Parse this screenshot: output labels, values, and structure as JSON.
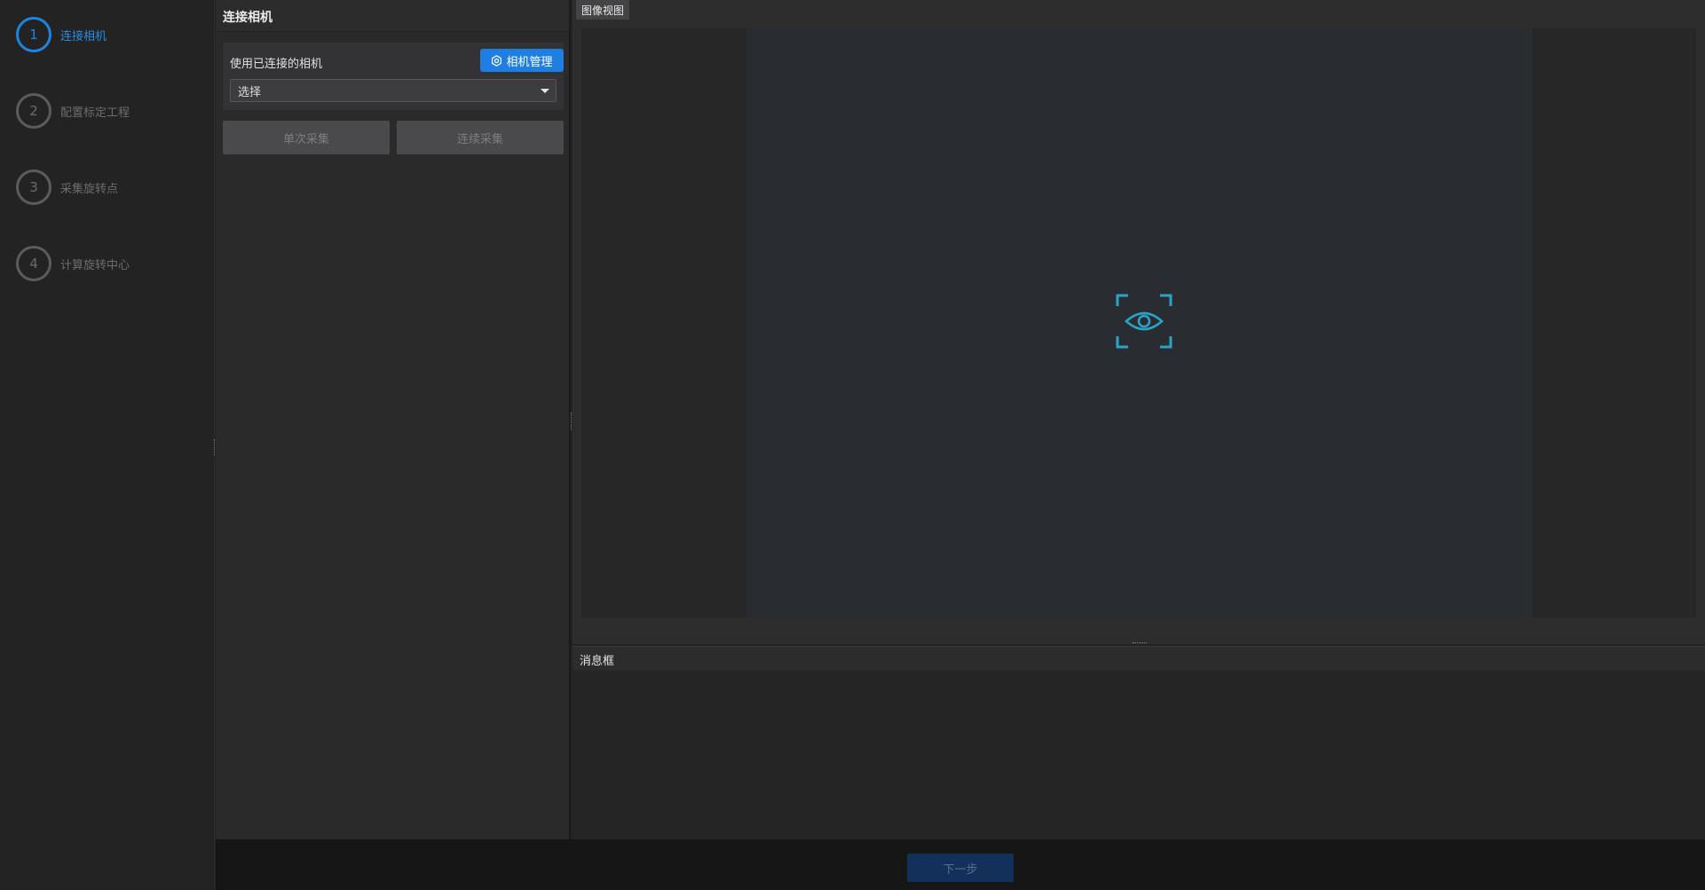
{
  "steps": [
    {
      "number": "1",
      "label": "连接相机",
      "active": true
    },
    {
      "number": "2",
      "label": "配置标定工程",
      "active": false
    },
    {
      "number": "3",
      "label": "采集旋转点",
      "active": false
    },
    {
      "number": "4",
      "label": "计算旋转中心",
      "active": false
    }
  ],
  "panel": {
    "title": "连接相机",
    "camera_label": "使用已连接的相机",
    "camera_manage_button": "相机管理",
    "select_value": "选择",
    "single_capture": "单次采集",
    "continuous_capture": "连续采集"
  },
  "image_view": {
    "tab_label": "图像视图",
    "placeholder_icon": "eye-focus-icon"
  },
  "message_box": {
    "title": "消息框"
  },
  "footer": {
    "next_button": "下一步"
  },
  "colors": {
    "accent": "#1f7fe0",
    "icon": "#2aa3c9"
  }
}
